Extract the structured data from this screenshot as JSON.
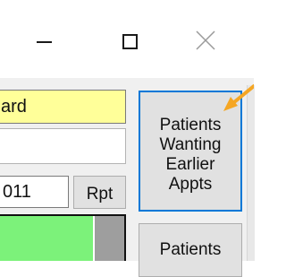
{
  "window": {
    "controls": {
      "minimize_icon": "minimize-icon",
      "maximize_icon": "maximize-icon",
      "close_icon": "close-icon"
    }
  },
  "form": {
    "patient_field_value": "ard",
    "date_field_value": "011",
    "rpt_label": "Rpt"
  },
  "side_buttons": {
    "earlier_appts_label": "Patients Wanting Earlier Appts",
    "patients_label": "Patients"
  },
  "colors": {
    "highlight_field": "#ffff99",
    "focus_border": "#0078d7",
    "grid_cell": "#7cf27a",
    "annotation_arrow": "#f5a623"
  }
}
